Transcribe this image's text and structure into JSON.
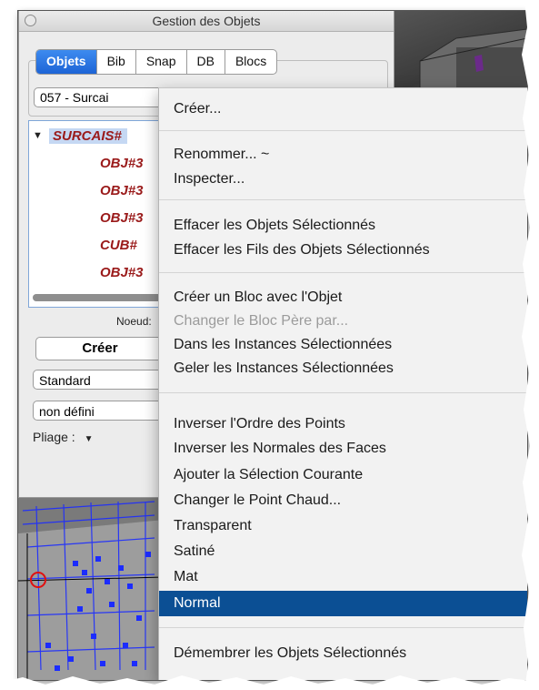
{
  "window": {
    "title": "Gestion des Objets"
  },
  "tabs": [
    {
      "label": "Objets",
      "active": true
    },
    {
      "label": "Bib",
      "active": false
    },
    {
      "label": "Snap",
      "active": false
    },
    {
      "label": "DB",
      "active": false
    },
    {
      "label": "Blocs",
      "active": false
    }
  ],
  "object_selector": {
    "value": "057 - Surcai"
  },
  "tree": {
    "root": "SURCAIS#",
    "children": [
      "OBJ#3",
      "OBJ#3",
      "OBJ#3",
      "CUB#",
      "OBJ#3"
    ]
  },
  "panel": {
    "noeud_label": "Noeud:",
    "create_button": "Créer",
    "style_value": "Standard",
    "type_value": "non défini",
    "pliage_label": "Pliage :"
  },
  "context_menu": {
    "items": [
      {
        "label": "Créer...",
        "state": "normal"
      },
      {
        "label": "Renommer... ~",
        "state": "normal"
      },
      {
        "label": "Inspecter...",
        "state": "normal"
      },
      {
        "label": "Effacer les Objets Sélectionnés",
        "state": "normal"
      },
      {
        "label": "Effacer les Fils des Objets Sélectionnés",
        "state": "normal"
      },
      {
        "label": "Créer un Bloc avec l'Objet",
        "state": "normal"
      },
      {
        "label": "Changer le Bloc Père par...",
        "state": "disabled"
      },
      {
        "label": "Dans les Instances Sélectionnées",
        "state": "normal"
      },
      {
        "label": "Geler les Instances Sélectionnées",
        "state": "normal"
      },
      {
        "label": "Inverser l'Ordre des Points",
        "state": "normal"
      },
      {
        "label": "Inverser les Normales des Faces",
        "state": "normal"
      },
      {
        "label": "Ajouter la Sélection Courante",
        "state": "normal"
      },
      {
        "label": "Changer le Point Chaud...",
        "state": "normal"
      },
      {
        "label": "Transparent",
        "state": "normal"
      },
      {
        "label": "Satiné",
        "state": "normal"
      },
      {
        "label": "Mat",
        "state": "normal"
      },
      {
        "label": "Normal",
        "state": "selected"
      },
      {
        "label": "Démembrer les Objets Sélectionnés",
        "state": "normal"
      }
    ]
  },
  "colors": {
    "selection": "#0b4f94",
    "tab_active": "#1d64d6",
    "tree_item_text": "#9a1a1a",
    "mesh_points": "#1c2cff",
    "marker": "#e01010"
  }
}
